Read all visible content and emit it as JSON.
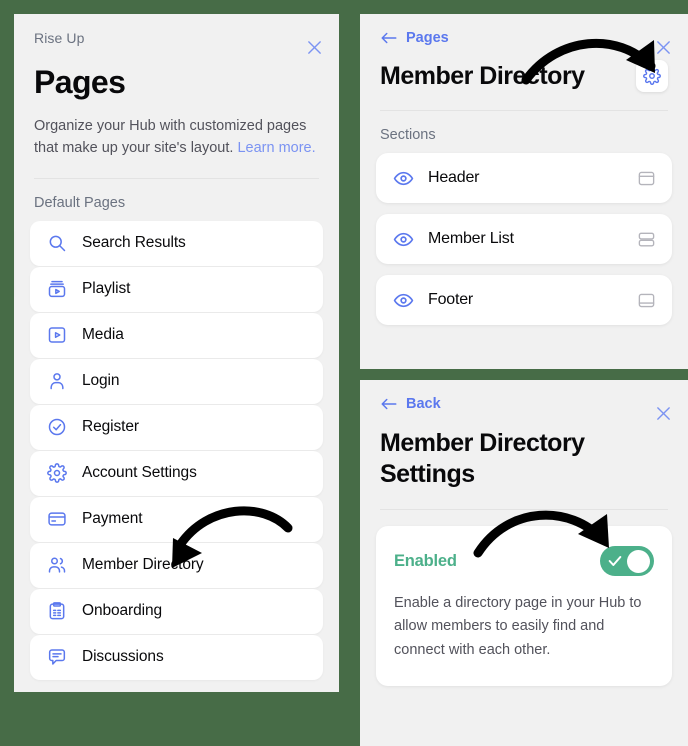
{
  "background_color": "#476c47",
  "accent_color": "#5b78ee",
  "link_color": "#7b93f2",
  "success_color": "#4cb08a",
  "pages_panel": {
    "brand": "Rise Up",
    "title": "Pages",
    "description_text": "Organize your Hub with customized pages that make up your site's layout. ",
    "description_link": "Learn more.",
    "close_label": "close-icon",
    "section_label": "Default Pages",
    "items": [
      {
        "label": "Search Results",
        "icon": "search-icon"
      },
      {
        "label": "Playlist",
        "icon": "playlist-icon"
      },
      {
        "label": "Media",
        "icon": "media-icon"
      },
      {
        "label": "Login",
        "icon": "user-icon"
      },
      {
        "label": "Register",
        "icon": "check-circle-icon"
      },
      {
        "label": "Account Settings",
        "icon": "gear-icon"
      },
      {
        "label": "Payment",
        "icon": "credit-card-icon"
      },
      {
        "label": "Member Directory",
        "icon": "users-icon"
      },
      {
        "label": "Onboarding",
        "icon": "clipboard-list-icon"
      },
      {
        "label": "Discussions",
        "icon": "chat-bubble-icon"
      }
    ]
  },
  "directory_panel": {
    "back_label": "Pages",
    "title": "Member Directory",
    "settings_button": "gear-icon",
    "section_label": "Sections",
    "sections": [
      {
        "label": "Header",
        "visibility_icon": "eye-icon",
        "layout_icon": "layout-header-icon"
      },
      {
        "label": "Member List",
        "visibility_icon": "eye-icon",
        "layout_icon": "layout-rows-icon"
      },
      {
        "label": "Footer",
        "visibility_icon": "eye-icon",
        "layout_icon": "layout-footer-icon"
      }
    ]
  },
  "settings_panel": {
    "back_label": "Back",
    "title": "Member Directory Settings",
    "toggle_label": "Enabled",
    "toggle_state": "on",
    "description": "Enable a directory page in your Hub to allow members to easily find and connect with each other."
  },
  "annotations": [
    {
      "name": "arrow-to-gear-button",
      "shape": "curved-arrow"
    },
    {
      "name": "arrow-to-member-directory",
      "shape": "curved-arrow"
    },
    {
      "name": "arrow-to-enabled-toggle",
      "shape": "curved-arrow"
    }
  ]
}
